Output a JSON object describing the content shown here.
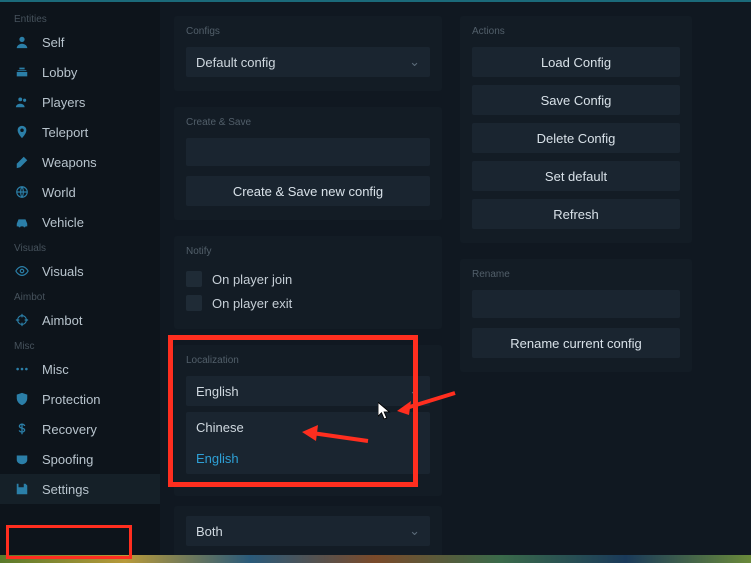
{
  "sidebar": {
    "sections": {
      "entities": "Entities",
      "visuals": "Visuals",
      "aimbot": "Aimbot",
      "misc": "Misc"
    },
    "items": {
      "self": "Self",
      "lobby": "Lobby",
      "players": "Players",
      "teleport": "Teleport",
      "weapons": "Weapons",
      "world": "World",
      "vehicle": "Vehicle",
      "visuals": "Visuals",
      "aimbot": "Aimbot",
      "misc": "Misc",
      "protection": "Protection",
      "recovery": "Recovery",
      "spoofing": "Spoofing",
      "settings": "Settings"
    }
  },
  "configs": {
    "title": "Configs",
    "selected": "Default config"
  },
  "create_save": {
    "title": "Create & Save",
    "button": "Create & Save new config"
  },
  "notify": {
    "title": "Notify",
    "join": "On player join",
    "exit": "On player exit"
  },
  "localization": {
    "title": "Localization",
    "selected": "English",
    "options": [
      "Chinese",
      "English"
    ],
    "ghost": "On player exit"
  },
  "both_select": {
    "value": "Both"
  },
  "actions": {
    "title": "Actions",
    "load": "Load Config",
    "save": "Save Config",
    "delete": "Delete Config",
    "default": "Set default",
    "refresh": "Refresh"
  },
  "rename": {
    "title": "Rename",
    "button": "Rename current config"
  }
}
